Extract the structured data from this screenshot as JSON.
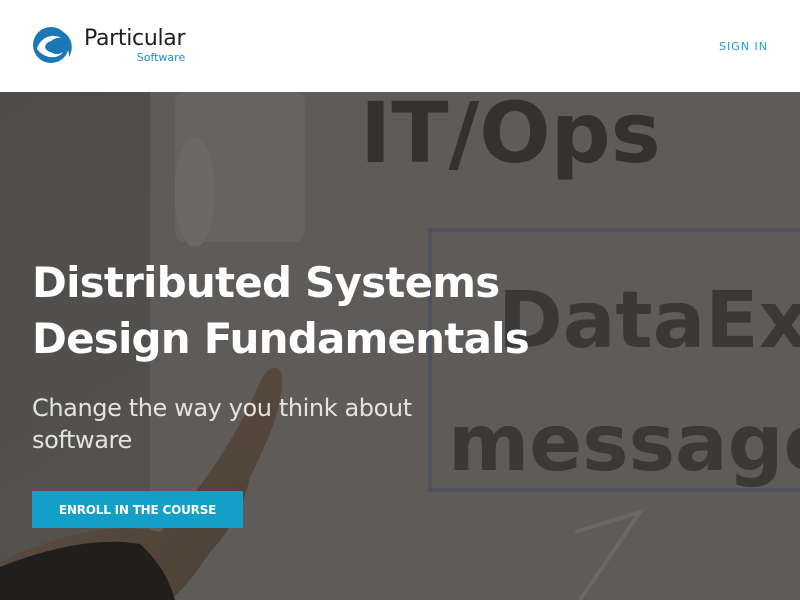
{
  "header": {
    "logo": {
      "name": "Particular",
      "sub": "Software",
      "icon": "wave-logo-icon",
      "colors": {
        "mark": "#1a78b4",
        "sub": "#1a8fc6"
      }
    },
    "signin_label": "SIGN IN"
  },
  "hero": {
    "background_words": [
      "IT/Ops",
      "DataExpo",
      "message"
    ],
    "title_line1": "Distributed Systems",
    "title_line2": "Design Fundamentals",
    "subtitle": "Change the way you think about software",
    "cta_label": "ENROLL IN THE COURSE"
  },
  "colors": {
    "accent": "#12a0c9",
    "link": "#1aa0c8"
  }
}
